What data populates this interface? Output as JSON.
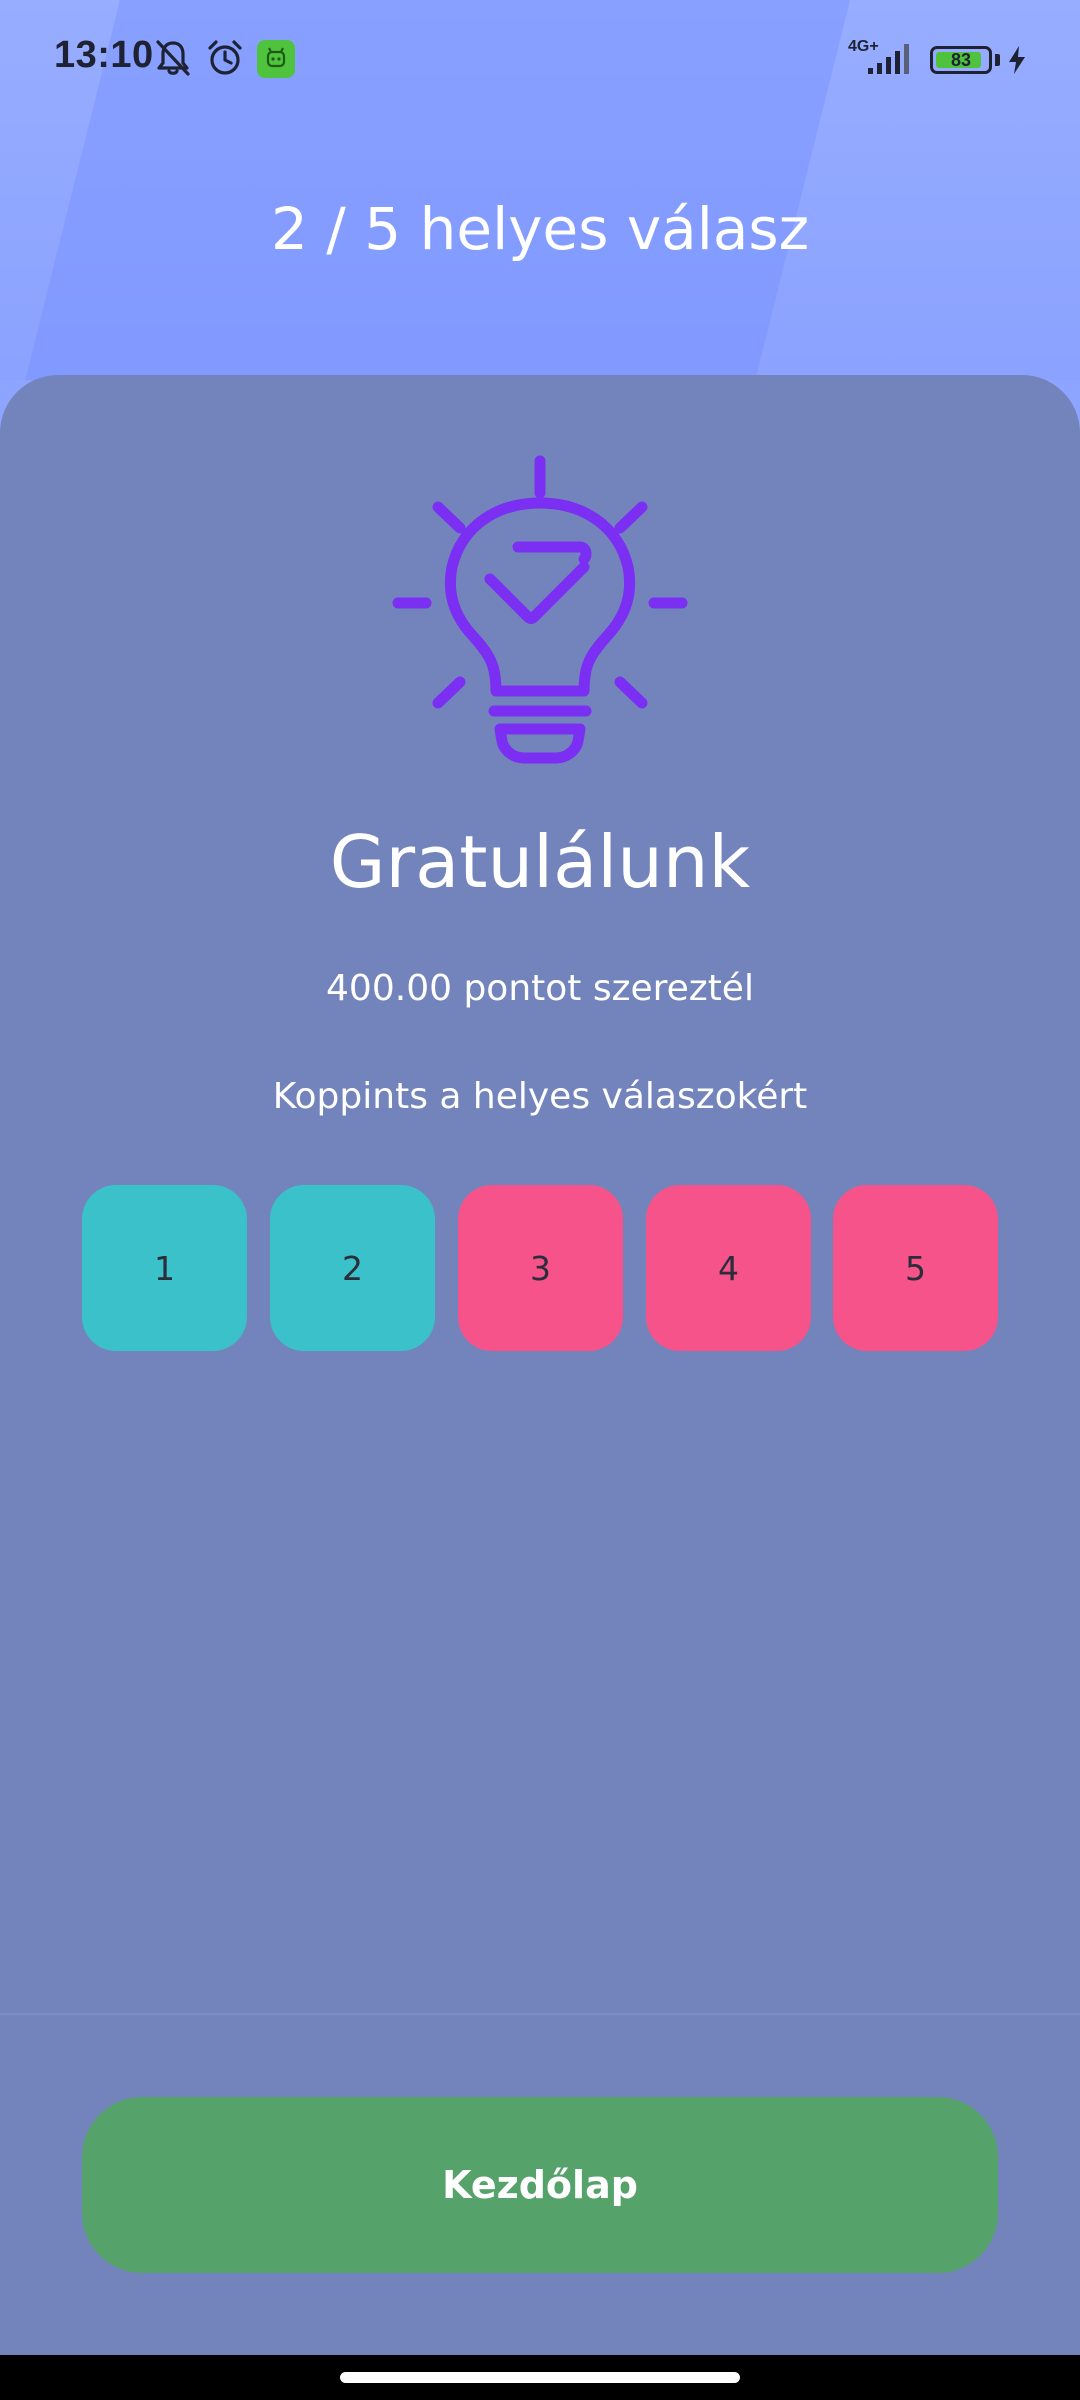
{
  "status_bar": {
    "time": "13:10",
    "network": "4G+",
    "battery_level": "83",
    "icons": [
      "mute-notifications-icon",
      "alarm-icon",
      "app-notification-icon",
      "signal-icon",
      "battery-icon",
      "charging-icon"
    ]
  },
  "header": {
    "score_text": "2 / 5 helyes válasz"
  },
  "result": {
    "icon": "lightbulb-check-icon",
    "title": "Gratulálunk",
    "points_text": "400.00 pontot szereztél",
    "hint_text": "Koppints a helyes válaszokért"
  },
  "answers": [
    {
      "label": "1",
      "status": "correct",
      "color": "#3ac1c9"
    },
    {
      "label": "2",
      "status": "correct",
      "color": "#3ac1c9"
    },
    {
      "label": "3",
      "status": "wrong",
      "color": "#f6538a"
    },
    {
      "label": "4",
      "status": "wrong",
      "color": "#f6538a"
    },
    {
      "label": "5",
      "status": "wrong",
      "color": "#f6538a"
    }
  ],
  "footer": {
    "home_button_label": "Kezdőlap"
  },
  "colors": {
    "card_background": "#7384bd",
    "header_background": "#8ea5ff",
    "icon_purple": "#7b2ff2",
    "correct": "#3ac1c9",
    "wrong": "#f6538a",
    "home_button": "#56a26b"
  }
}
